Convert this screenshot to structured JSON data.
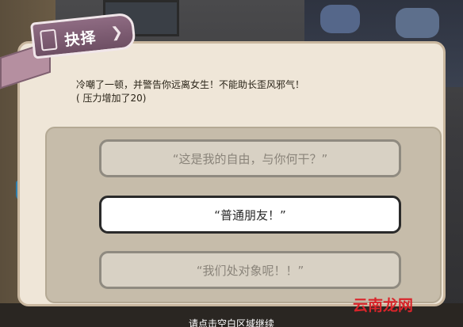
{
  "ribbon": {
    "title": "抉择"
  },
  "message": {
    "line1": "冷嘲了一顿，并警告你远离女生！不能助长歪风邪气！",
    "line2": "( 压力增加了20)"
  },
  "options": [
    {
      "label": "“这是我的自由，与你何干？”",
      "state": "disabled"
    },
    {
      "label": "“普通朋友！”",
      "state": "active"
    },
    {
      "label": "“我们处对象呢！！”",
      "state": "disabled"
    }
  ],
  "footer": {
    "hint": "请点击空白区域继续"
  },
  "watermark": {
    "text": "云南龙网"
  },
  "colors": {
    "dialog_bg": "#efe6d8",
    "panel_bg": "#c6bcaa",
    "ribbon": "#7d5c72",
    "watermark": "#d9242a"
  }
}
